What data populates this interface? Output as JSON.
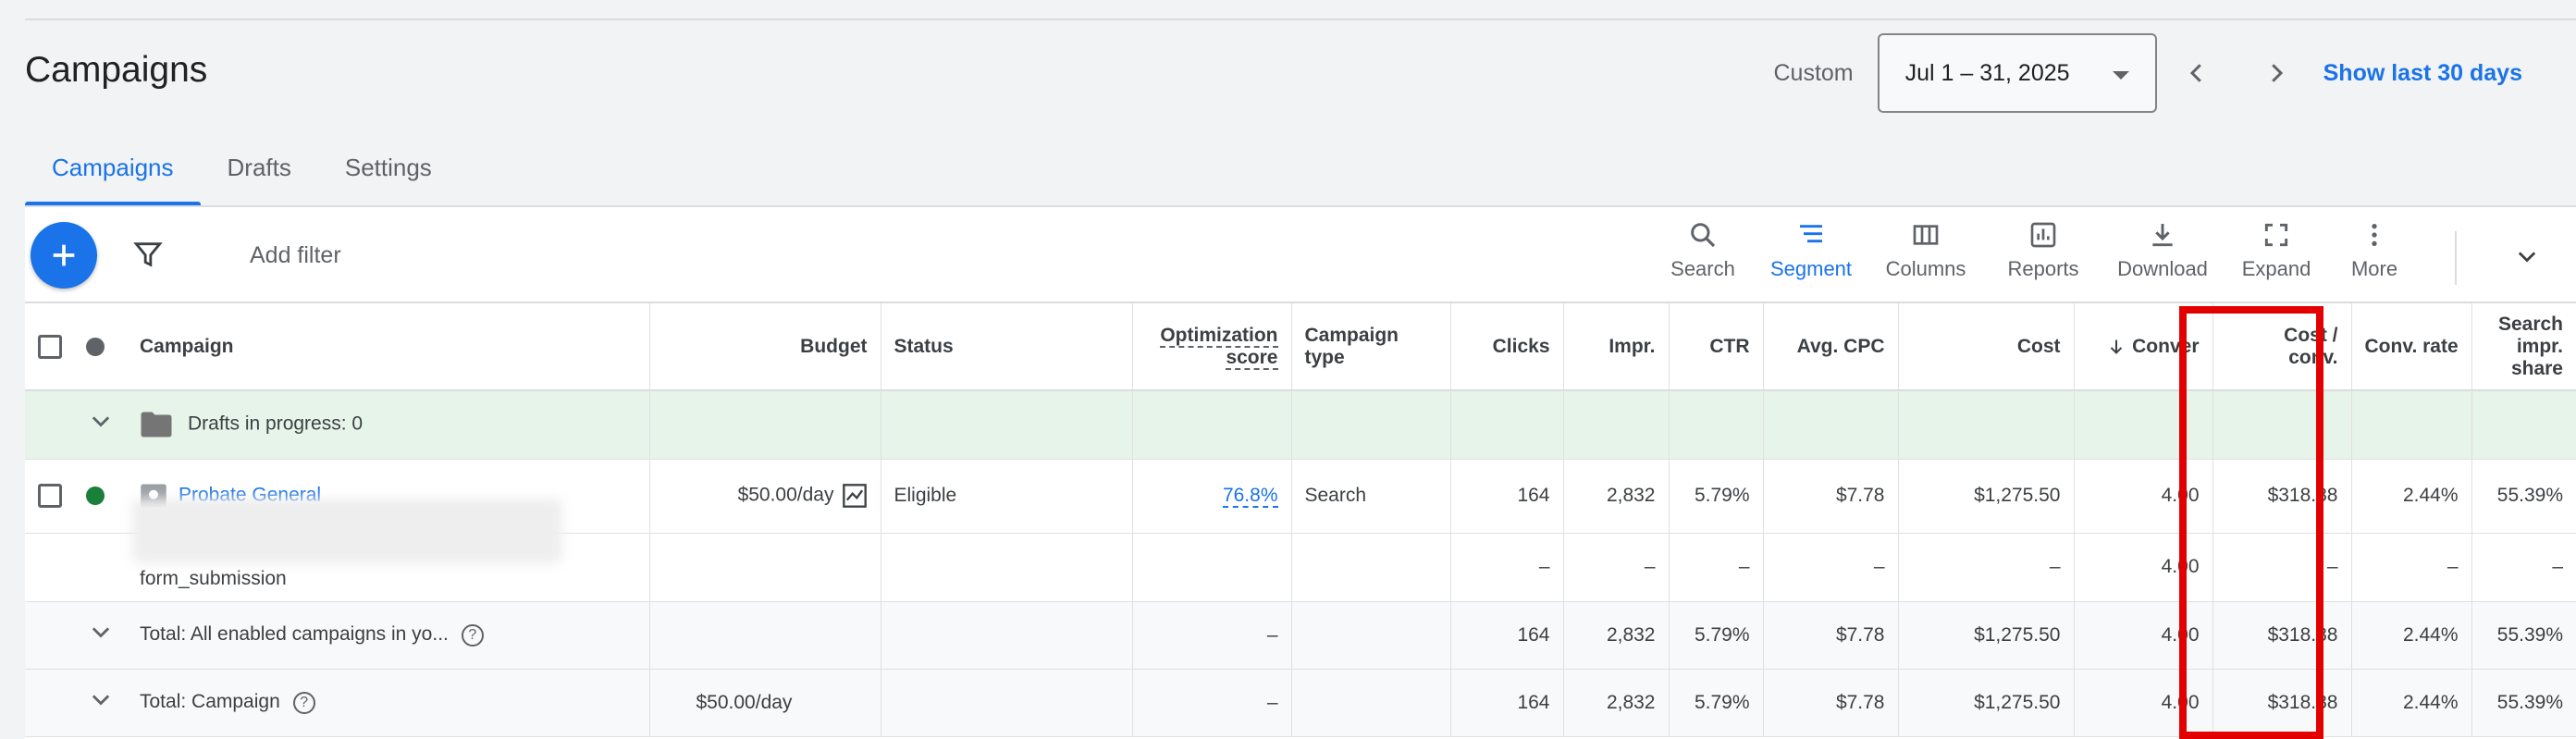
{
  "page": {
    "title": "Campaigns"
  },
  "date_range": {
    "custom_label": "Custom",
    "value": "Jul 1 – 31, 2025",
    "show_last": "Show last 30 days"
  },
  "tabs": [
    {
      "label": "Campaigns",
      "active": true
    },
    {
      "label": "Drafts",
      "active": false
    },
    {
      "label": "Settings",
      "active": false
    }
  ],
  "toolbar": {
    "add_filter": "Add filter",
    "buttons": {
      "search": "Search",
      "segment": "Segment",
      "columns": "Columns",
      "reports": "Reports",
      "download": "Download",
      "expand": "Expand",
      "more": "More"
    }
  },
  "columns": {
    "campaign": "Campaign",
    "budget": "Budget",
    "status": "Status",
    "optimization_1": "Optimization",
    "optimization_2": "score",
    "campaign_type_1": "Campaign",
    "campaign_type_2": "type",
    "clicks": "Clicks",
    "impr": "Impr.",
    "ctr": "CTR",
    "avg_cpc": "Avg. CPC",
    "cost": "Cost",
    "conversions": "Conver",
    "cost_conv_1": "Cost /",
    "cost_conv_2": "conv.",
    "conv_rate": "Conv. rate",
    "search_impr_1": "Search",
    "search_impr_2": "impr. share"
  },
  "drafts_row": {
    "label": "Drafts in progress: 0"
  },
  "campaign_row": {
    "name": "Probate General",
    "budget": "$50.00/day",
    "status": "Eligible",
    "optimization_score": "76.8%",
    "campaign_type": "Search",
    "clicks": "164",
    "impr": "2,832",
    "ctr": "5.79%",
    "avg_cpc": "$7.78",
    "cost": "$1,275.50",
    "conversions": "4.00",
    "cost_conv": "$318.88",
    "conv_rate": "2.44%",
    "search_impr_share": "55.39%"
  },
  "conversion_action_row": {
    "name": "form_submission",
    "clicks": "–",
    "impr": "–",
    "ctr": "–",
    "avg_cpc": "–",
    "cost": "–",
    "conversions": "4.00",
    "cost_conv": "–",
    "conv_rate": "–",
    "search_impr_share": "–"
  },
  "total_enabled_row": {
    "label": "Total: All enabled campaigns in yo...",
    "optimization_score": "–",
    "clicks": "164",
    "impr": "2,832",
    "ctr": "5.79%",
    "avg_cpc": "$7.78",
    "cost": "$1,275.50",
    "conversions": "4.00",
    "cost_conv": "$318.88",
    "conv_rate": "2.44%",
    "search_impr_share": "55.39%"
  },
  "total_campaign_row": {
    "label": "Total: Campaign",
    "budget": "$50.00/day",
    "optimization_score": "–",
    "clicks": "164",
    "impr": "2,832",
    "ctr": "5.79%",
    "avg_cpc": "$7.78",
    "cost": "$1,275.50",
    "conversions": "4.00",
    "cost_conv": "$318.88",
    "conv_rate": "2.44%",
    "search_impr_share": "55.39%"
  },
  "colors": {
    "accent": "#1a73e8",
    "enabled_dot": "#188038",
    "header_dot": "#5f6368",
    "draft_row_bg": "#e6f4ea",
    "highlight_box": "#e30000"
  }
}
